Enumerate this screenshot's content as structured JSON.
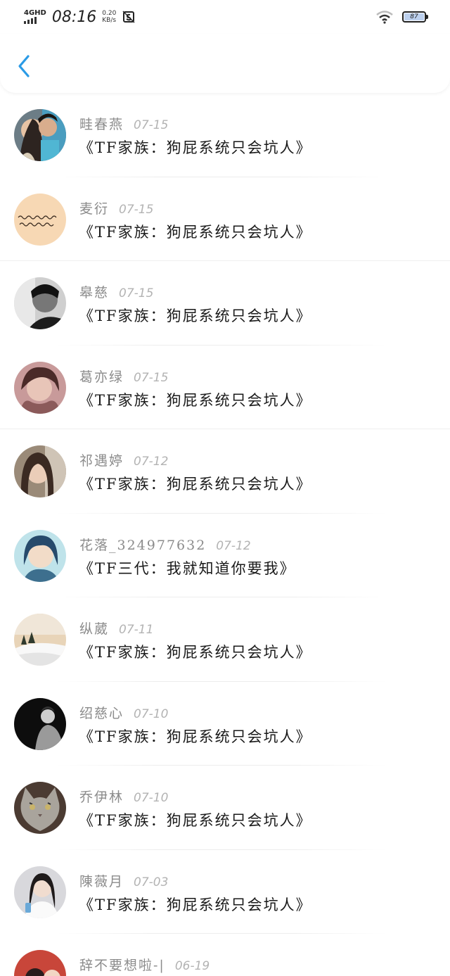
{
  "status_bar": {
    "network": "4GHD",
    "time": "08:16",
    "speed_value": "0.20",
    "speed_unit": "KB/s",
    "battery": "87"
  },
  "nav": {
    "back_icon": "chevron-left-icon",
    "accent": "#2b9be6"
  },
  "messages": [
    {
      "name": "畦春燕",
      "date": "07-15",
      "text": "《TF家族：狗屁系统只会坑人》"
    },
    {
      "name": "麦衍",
      "date": "07-15",
      "text": "《TF家族：狗屁系统只会坑人》"
    },
    {
      "name": "皋慈",
      "date": "07-15",
      "text": "《TF家族：狗屁系统只会坑人》"
    },
    {
      "name": "葛亦绿",
      "date": "07-15",
      "text": "《TF家族：狗屁系统只会坑人》"
    },
    {
      "name": "祁遇婷",
      "date": "07-12",
      "text": "《TF家族：狗屁系统只会坑人》"
    },
    {
      "name": "花落_324977632",
      "date": "07-12",
      "text": "《TF三代：我就知道你要我》"
    },
    {
      "name": "纵葳",
      "date": "07-11",
      "text": "《TF家族：狗屁系统只会坑人》"
    },
    {
      "name": "绍慈心",
      "date": "07-10",
      "text": "《TF家族：狗屁系统只会坑人》"
    },
    {
      "name": "乔伊林",
      "date": "07-10",
      "text": "《TF家族：狗屁系统只会坑人》"
    },
    {
      "name": "陳薇月",
      "date": "07-03",
      "text": "《TF家族：狗屁系统只会坑人》"
    },
    {
      "name": "辞不要想啦-|",
      "date": "06-19",
      "text": ""
    }
  ]
}
